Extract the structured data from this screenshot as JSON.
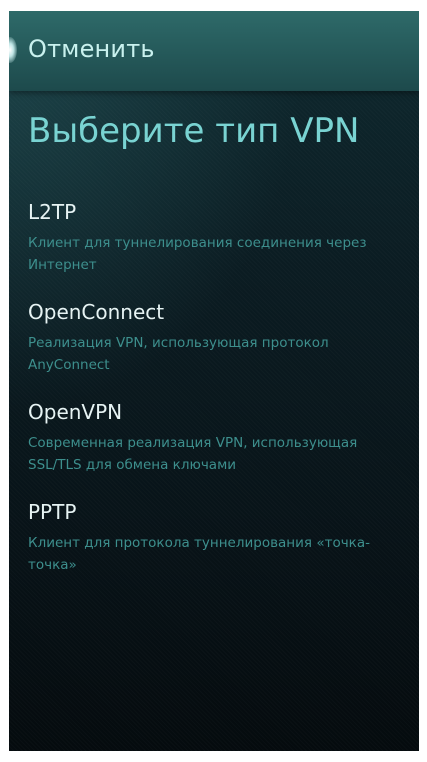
{
  "header": {
    "cancel_label": "Отменить"
  },
  "page_title": "Выберите тип VPN",
  "vpn_types": [
    {
      "name": "L2TP",
      "description": "Клиент для туннелирования соединения через Интернет"
    },
    {
      "name": "OpenConnect",
      "description": "Реализация VPN, использующая протокол AnyConnect"
    },
    {
      "name": "OpenVPN",
      "description": "Современная реализация VPN, использующая SSL/TLS для обмена ключами"
    },
    {
      "name": "PPTP",
      "description": "Клиент для протокола туннелирования «точка-точка»"
    }
  ],
  "colors": {
    "accent": "#79d3d2",
    "header": "#2e6a69",
    "secondary_text": "#3d8f8d",
    "primary_text": "#e6f3f3"
  }
}
